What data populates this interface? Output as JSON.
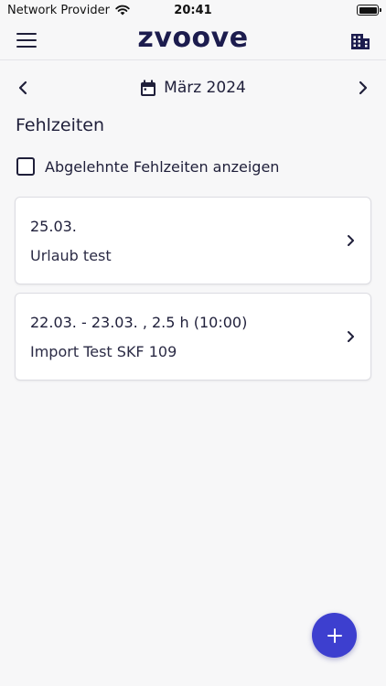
{
  "status_bar": {
    "carrier": "Network Provider",
    "time": "20:41",
    "wifi_icon": "wifi-icon",
    "battery_icon": "battery-icon"
  },
  "app_bar": {
    "menu_icon": "hamburger-menu-icon",
    "brand": "zvoove",
    "building_icon": "building-icon"
  },
  "month_nav": {
    "prev_icon": "chevron-left-icon",
    "calendar_icon": "calendar-icon",
    "label": "März 2024",
    "next_icon": "chevron-right-icon"
  },
  "section": {
    "title": "Fehlzeiten",
    "show_rejected_label": "Abgelehnte Fehlzeiten anzeigen",
    "show_rejected_checked": false
  },
  "absences": [
    {
      "date": "25.03.",
      "title": "Urlaub test"
    },
    {
      "date": "22.03.  - 23.03. , 2.5 h (10:00)",
      "title": "Import Test SKF 109"
    }
  ],
  "fab": {
    "icon": "plus-icon"
  },
  "colors": {
    "accent": "#3d3fcf",
    "text": "#1f1f3a",
    "background": "#f7f7f8",
    "brand": "#1c1c4e"
  }
}
